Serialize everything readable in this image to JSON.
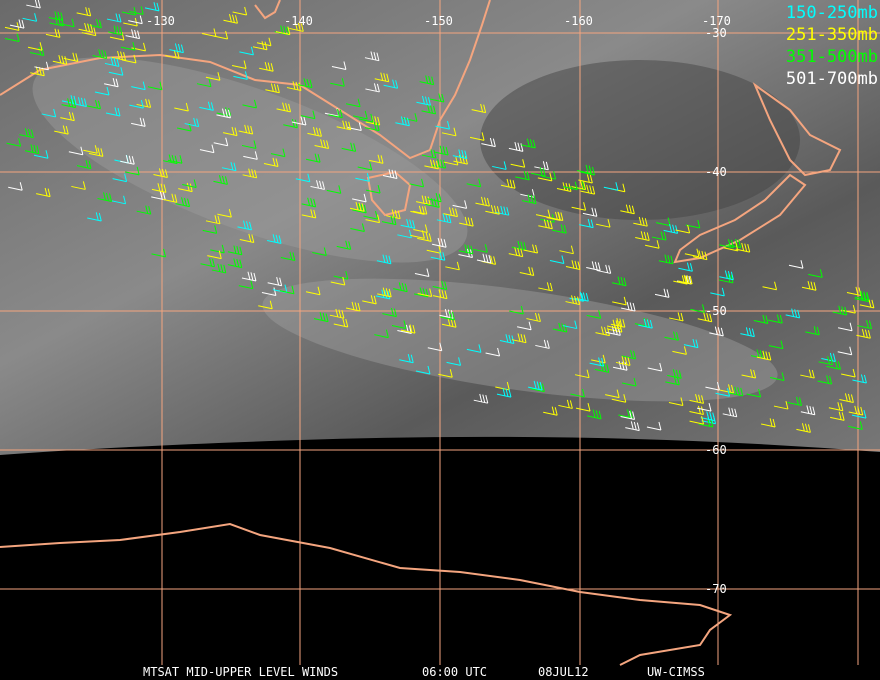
{
  "legend": [
    {
      "label": "150-250mb",
      "color": "#00ffff"
    },
    {
      "label": "251-350mb",
      "color": "#ffff00"
    },
    {
      "label": "351-500mb",
      "color": "#00ff00"
    },
    {
      "label": "501-700mb",
      "color": "#ffffff"
    }
  ],
  "longitude_labels": [
    "-130",
    "-140",
    "-150",
    "-160",
    "-170"
  ],
  "latitude_labels": [
    "-30",
    "-40",
    "-50",
    "-60",
    "-70"
  ],
  "caption": {
    "product": "MTSAT MID-UPPER LEVEL WINDS",
    "time": "06:00 UTC",
    "date": "08JUL12",
    "source": "UW-CIMSS"
  },
  "colors": {
    "grid": "#f4a57f",
    "coast": "#f4a57f"
  }
}
